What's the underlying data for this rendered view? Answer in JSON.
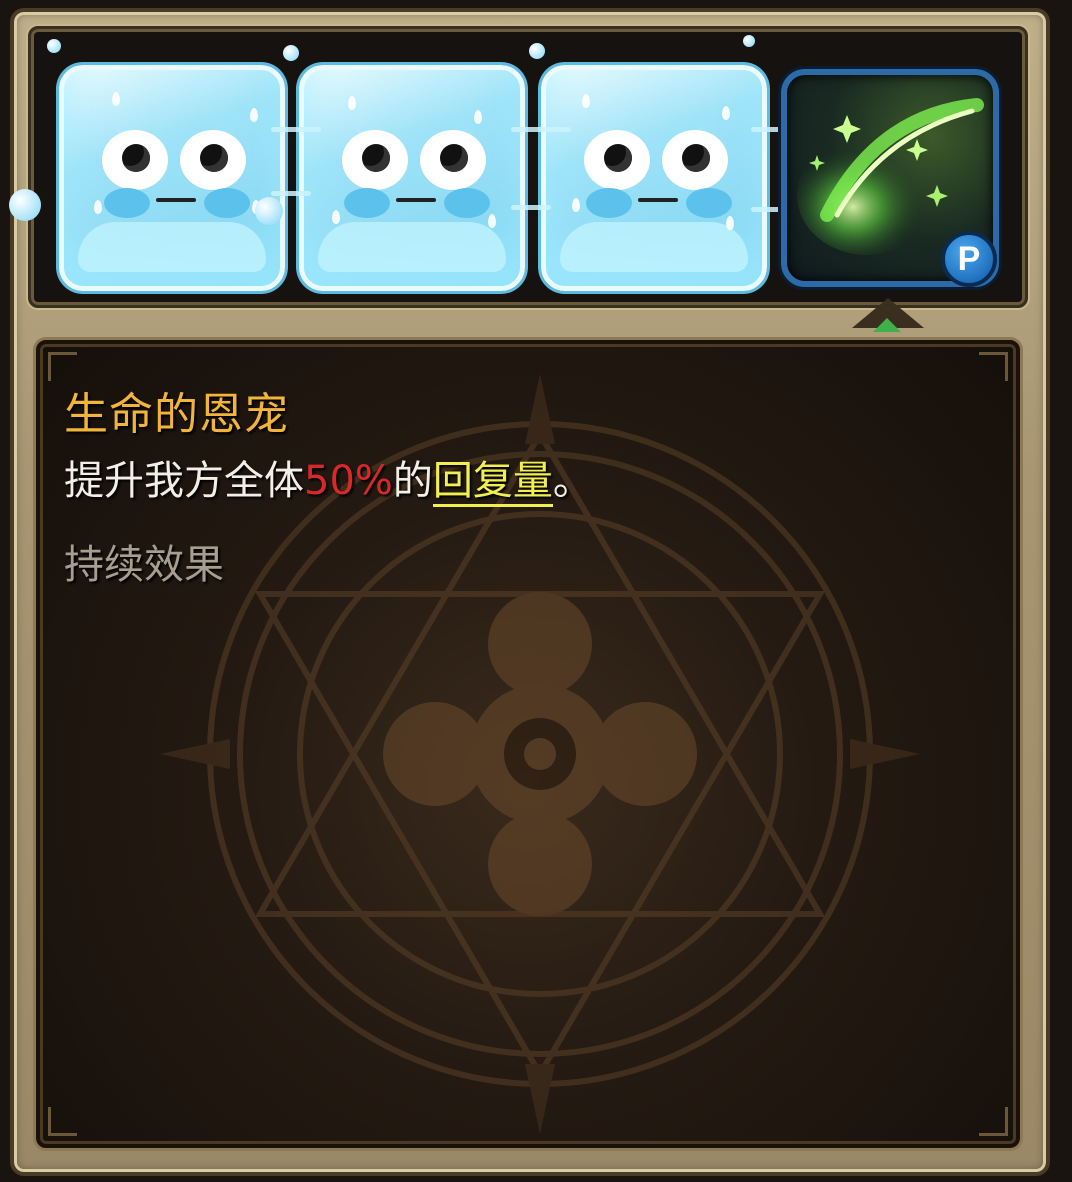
{
  "skill_bar": {
    "slots": [
      {
        "type": "ice-block",
        "icon": "ice-cube-face-icon"
      },
      {
        "type": "ice-block",
        "icon": "ice-cube-face-icon"
      },
      {
        "type": "ice-block",
        "icon": "ice-cube-face-icon"
      },
      {
        "type": "skill",
        "icon": "green-sparkle-skill-icon",
        "badge": "P",
        "selected": true
      }
    ]
  },
  "skill_info": {
    "title": "生命的恩宠",
    "desc_prefix": "提升我方全体",
    "desc_value": "50%",
    "desc_mid": "的",
    "desc_keyword": "回复量",
    "desc_suffix": "。",
    "effect_type": "持续效果"
  },
  "colors": {
    "title": "#f2b53a",
    "value": "#d8282a",
    "keyword": "#f1f050",
    "effect_type": "#a89e90"
  }
}
